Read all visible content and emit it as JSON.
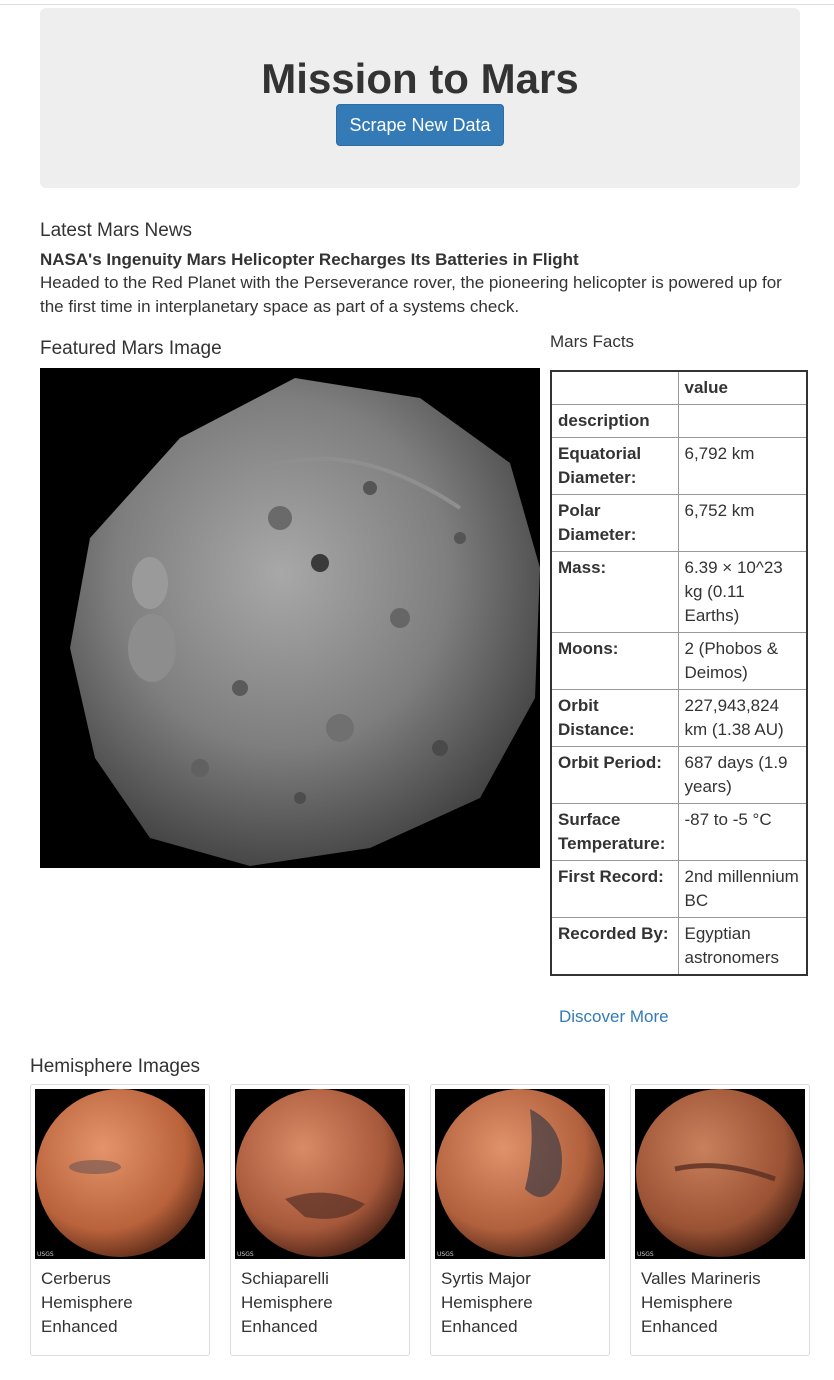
{
  "jumbotron": {
    "title": "Mission to Mars",
    "button_label": "Scrape New Data"
  },
  "news": {
    "heading": "Latest Mars News",
    "title": "NASA's Ingenuity Mars Helicopter Recharges Its Batteries in Flight",
    "body": "Headed to the Red Planet with the Perseverance rover, the pioneering helicopter is powered up for the first time in interplanetary space as part of a systems check."
  },
  "featured": {
    "heading": "Featured Mars Image"
  },
  "facts": {
    "heading": "Mars Facts",
    "column_header": "value",
    "index_label": "description",
    "rows": [
      {
        "label": "Equatorial Diameter:",
        "value": "6,792 km"
      },
      {
        "label": "Polar Diameter:",
        "value": "6,752 km"
      },
      {
        "label": "Mass:",
        "value": "6.39 × 10^23 kg (0.11 Earths)"
      },
      {
        "label": "Moons:",
        "value": "2 (Phobos & Deimos)"
      },
      {
        "label": "Orbit Distance:",
        "value": "227,943,824 km (1.38 AU)"
      },
      {
        "label": "Orbit Period:",
        "value": "687 days (1.9 years)"
      },
      {
        "label": "Surface Temperature:",
        "value": "-87 to -5 °C"
      },
      {
        "label": "First Record:",
        "value": "2nd millennium BC"
      },
      {
        "label": "Recorded By:",
        "value": "Egyptian astronomers"
      }
    ],
    "discover_link": "Discover More"
  },
  "hemispheres": {
    "heading": "Hemisphere Images",
    "items": [
      {
        "title": "Cerberus Hemisphere Enhanced",
        "logo": "USGS"
      },
      {
        "title": "Schiaparelli Hemisphere Enhanced",
        "logo": "USGS"
      },
      {
        "title": "Syrtis Major Hemisphere Enhanced",
        "logo": "USGS"
      },
      {
        "title": "Valles Marineris Hemisphere Enhanced",
        "logo": "USGS"
      }
    ]
  },
  "colors": {
    "primary": "#337ab7",
    "jumbotron_bg": "#eeeeee",
    "text": "#333333"
  }
}
